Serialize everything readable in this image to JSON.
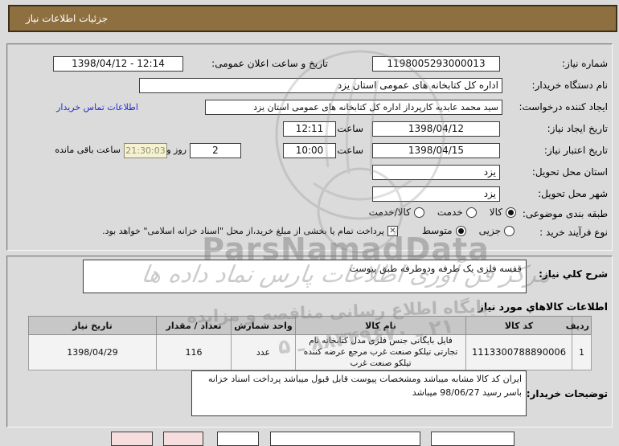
{
  "title_bar": {
    "label": "جزئیات اطلاعات نیاز"
  },
  "details": {
    "need_number": {
      "label": "شماره نیاز:",
      "value": "1198005293000013"
    },
    "announce": {
      "label": "تاریخ و ساعت اعلان عمومی:",
      "value": "1398/04/12 - 12:14"
    },
    "buyer_org": {
      "label": "نام دستگاه خریدار:",
      "value": "اداره کل کتابخانه های عمومی استان یزد"
    },
    "creator": {
      "label": "ایجاد کننده درخواست:",
      "value": "سید محمد عابدیه کارپرداز اداره کل کتابخانه های عمومی استان یزد",
      "contact_link": "اطلاعات تماس خریدار"
    },
    "created": {
      "label": "تاریخ ایجاد نیاز:",
      "date": "1398/04/12",
      "hour_label": "ساعت",
      "time": "12:11"
    },
    "validity": {
      "label": "تاریخ اعتبار نیاز:",
      "date": "1398/04/15",
      "hour_label": "ساعت",
      "time": "10:00",
      "days_value": "2",
      "days_label": "روز و",
      "countdown": "21:30:03",
      "countdown_label": "ساعت باقی مانده"
    },
    "province": {
      "label": "استان محل تحویل:",
      "value": "یزد"
    },
    "city": {
      "label": "شهر محل تحویل:",
      "value": "یزد"
    },
    "classification": {
      "label": "طبقه بندی موضوعی:",
      "options": [
        {
          "label": "کالا",
          "selected": true
        },
        {
          "label": "خدمت",
          "selected": false
        },
        {
          "label": "کالا/خدمت",
          "selected": false
        }
      ]
    },
    "process": {
      "label": "نوع فرآیند خرید :",
      "options": [
        {
          "label": "جزیی",
          "selected": false
        },
        {
          "label": "متوسط",
          "selected": true
        }
      ],
      "treasury_checked": true,
      "treasury_text": "پرداخت تمام یا بخشی از مبلغ خرید،از محل \"اسناد خزانه اسلامی\" خواهد بود."
    }
  },
  "description": {
    "label": "شرح کلي نیاز:",
    "value": "قفسه فلزی یک طرفه ودوطرفه طبق پیوست"
  },
  "items": {
    "heading": "اطلاعات کالاهاي مورد نیاز",
    "headers": [
      "ردیف",
      "کد کالا",
      "نام کالا",
      "واحد شمارش",
      "تعداد / مقدار",
      "تاریخ نیاز"
    ],
    "rows": [
      [
        "1",
        "1113300788890006",
        "فایل بایگانی جنس فلزی مدل کتابخانه نام تجارتی تیلکو صنعت غرب مرجع عرضه کننده تیلکو صنعت غرب",
        "عدد",
        "116",
        "1398/04/29"
      ]
    ]
  },
  "buyer_notes": {
    "label": "توضیحات خریدار:",
    "value": "ایران کد کالا مشابه میباشد  ومشخصات پیوست قابل قبول میباشد پرداخت اسناد خزانه باسر رسید 98/06/27 میباشد"
  },
  "watermark": {
    "brand": "ParsNamadData",
    "calligraphy": "مرکز فن آوری اطلاعات پارس نماد داده ها",
    "tagline": "پایگاه اطلاع رسانی مناقصه و مزایده",
    "phone": "۲۱ ـ ۸۸۳۴۹۶۷۰ ـ ۵"
  },
  "colors": {
    "titlebar_bg": "#8e6f40",
    "page_bg": "#dbdbdb",
    "link_blue": "#2330c8",
    "countdown_bg": "#f6f2d1",
    "table_header_bg": "#c7c7c7",
    "pink_button_bg": "#f7dede"
  }
}
